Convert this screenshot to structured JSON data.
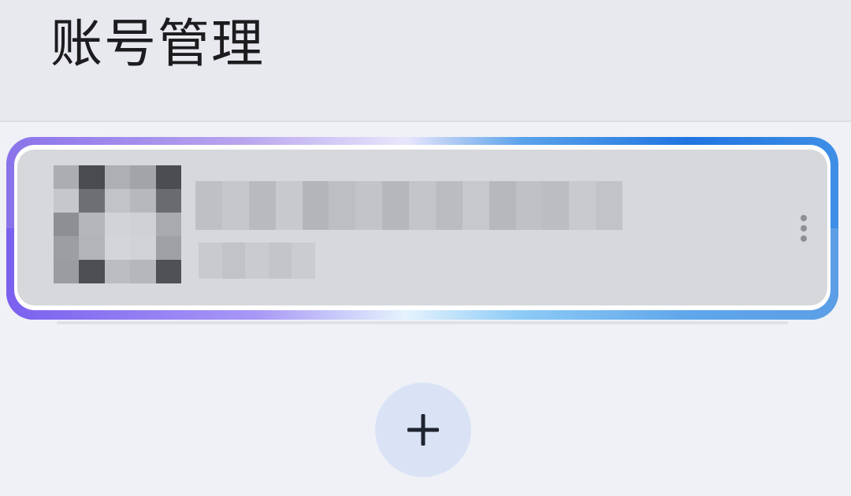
{
  "header": {
    "title": "账号管理"
  },
  "account_card": {
    "avatar": {
      "icon": "pixelated-avatar",
      "redacted": true
    },
    "name_redacted": true,
    "subtitle_redacted": true,
    "more_icon": "more-vertical-icon"
  },
  "add_button": {
    "icon": "plus-icon"
  },
  "colors": {
    "page_background": "#eff1f6",
    "header_background": "#e8e9ee",
    "card_background": "#d7d8dc",
    "add_button_background": "#d9e3f5",
    "glow_purple": "#8a72ea",
    "glow_blue": "#1f74e0",
    "title_text": "#1c1c1f"
  }
}
